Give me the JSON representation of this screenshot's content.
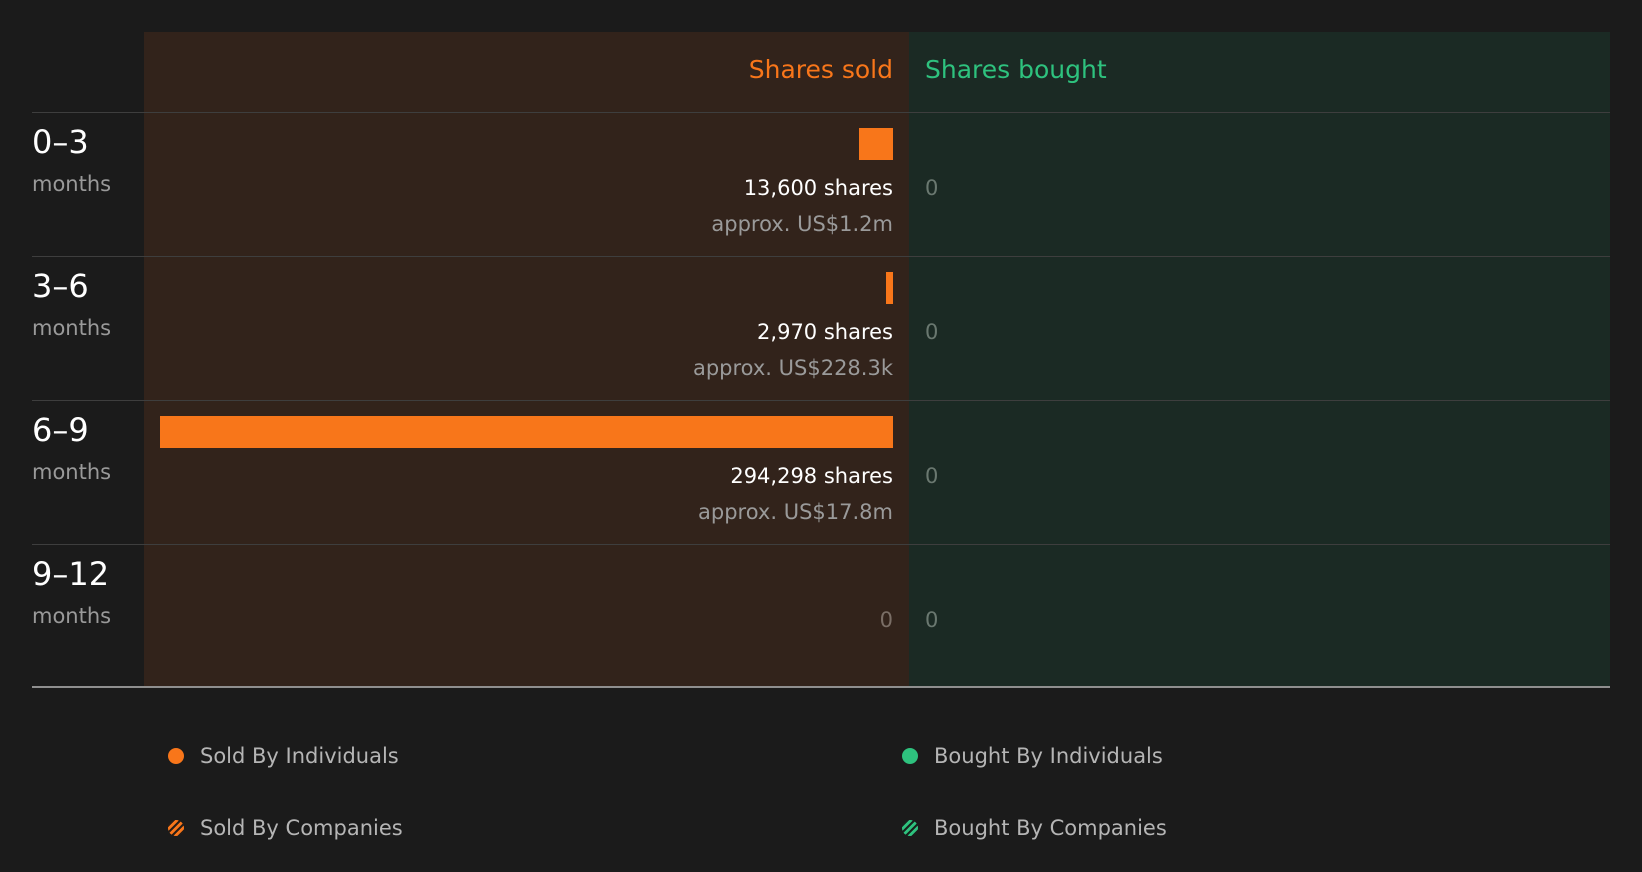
{
  "colors": {
    "sold": "#f8761a",
    "bought": "#2ec27e"
  },
  "chart_data": {
    "type": "bar",
    "orientation": "diverging-horizontal",
    "headers": {
      "sold": "Shares sold",
      "bought": "Shares bought"
    },
    "categories": [
      "0–3",
      "3–6",
      "6–9",
      "9–12"
    ],
    "category_unit": "months",
    "series": [
      {
        "name": "Shares sold",
        "values": [
          13600,
          2970,
          294298,
          0
        ]
      },
      {
        "name": "Shares bought",
        "values": [
          0,
          0,
          0,
          0
        ]
      }
    ],
    "rows": [
      {
        "period": "0–3",
        "unit": "months",
        "sold_shares": 13600,
        "sold_label": "13,600 shares",
        "sold_value_label": "approx. US$1.2m",
        "bought_label": "0"
      },
      {
        "period": "3–6",
        "unit": "months",
        "sold_shares": 2970,
        "sold_label": "2,970 shares",
        "sold_value_label": "approx. US$228.3k",
        "bought_label": "0"
      },
      {
        "period": "6–9",
        "unit": "months",
        "sold_shares": 294298,
        "sold_label": "294,298 shares",
        "sold_value_label": "approx. US$17.8m",
        "bought_label": "0"
      },
      {
        "period": "9–12",
        "unit": "months",
        "sold_shares": 0,
        "sold_label": "0",
        "sold_value_label": "",
        "bought_label": "0"
      }
    ],
    "legend": [
      "Sold By Individuals",
      "Bought By Individuals",
      "Sold By Companies",
      "Bought By Companies"
    ]
  }
}
